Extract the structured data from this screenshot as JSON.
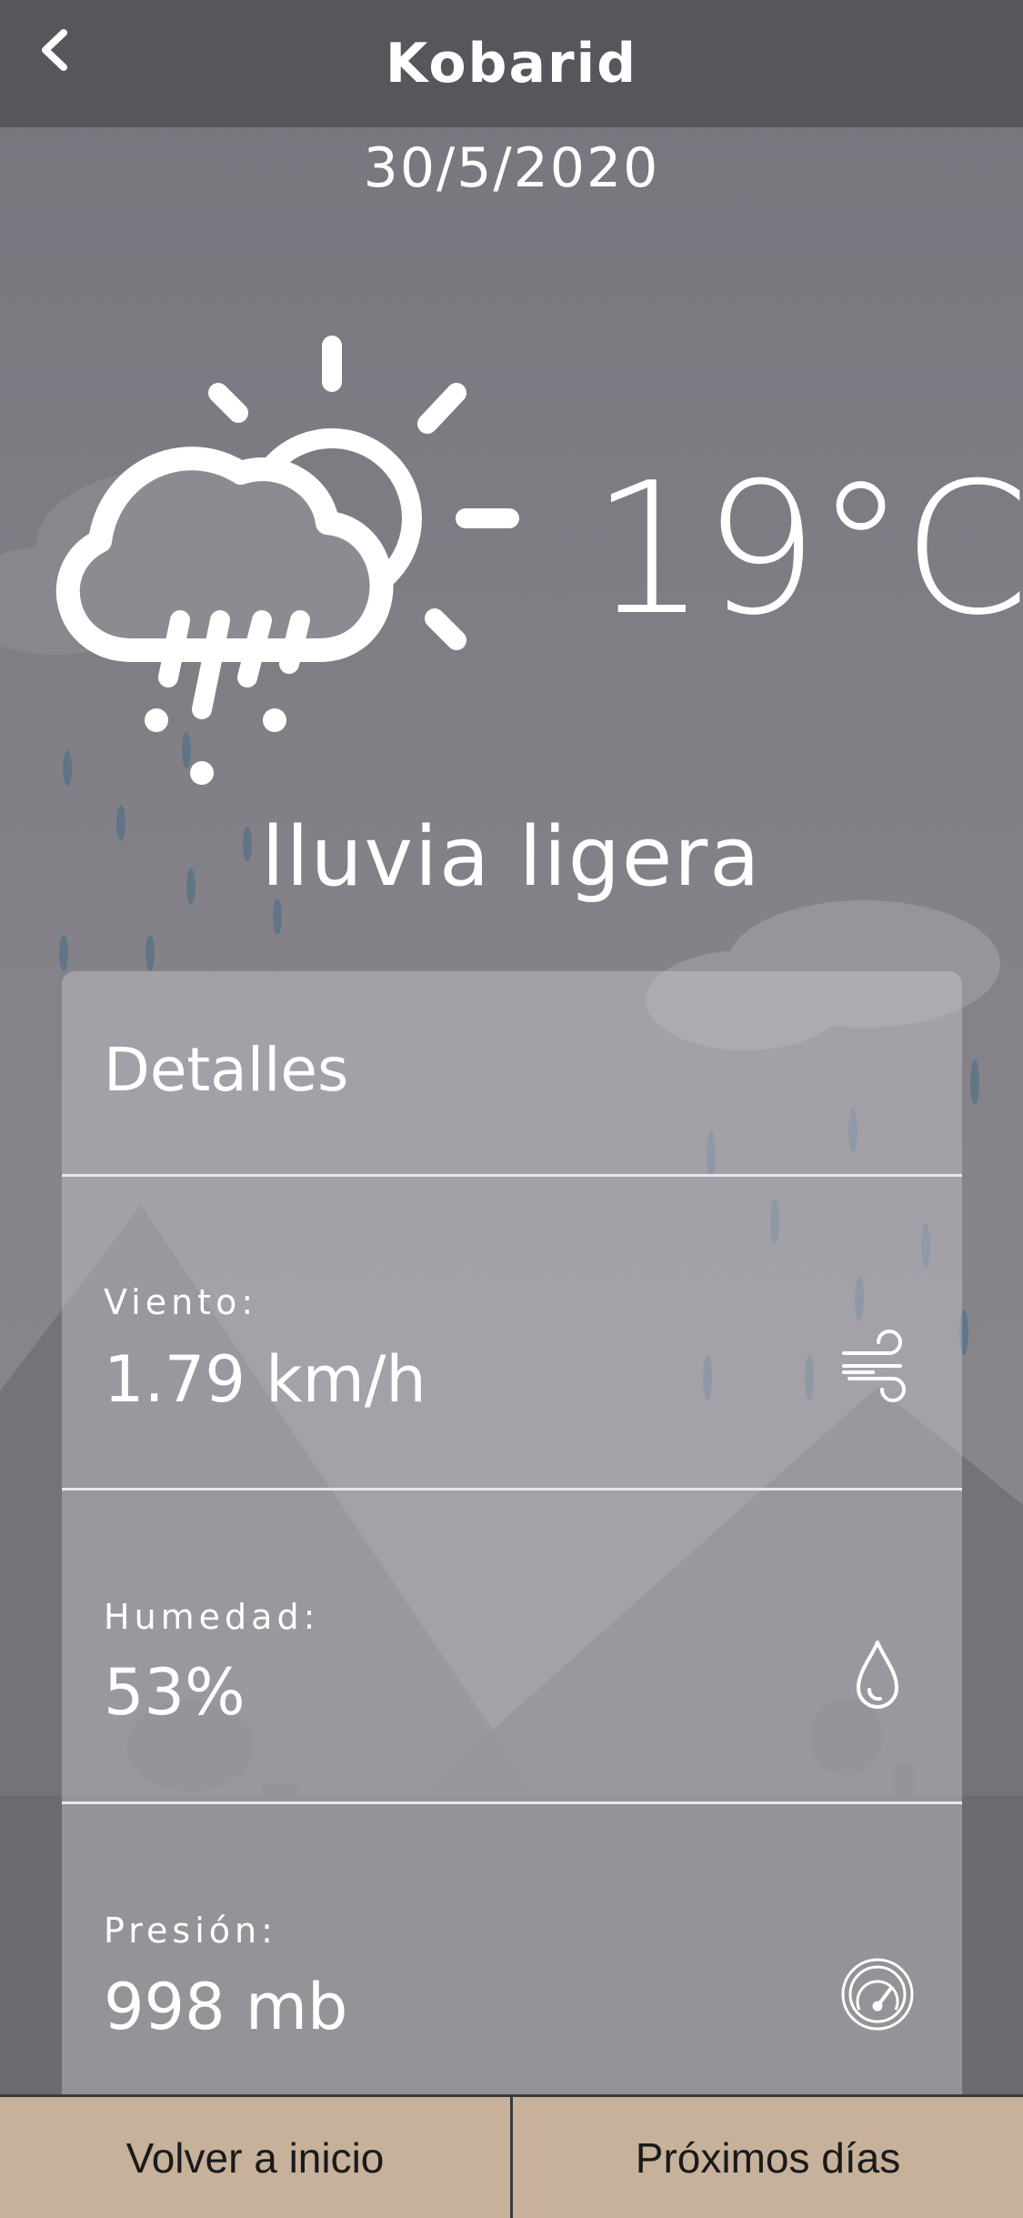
{
  "header": {
    "title": "Kobarid"
  },
  "date": "30/5/2020",
  "current": {
    "temperature": "19°C",
    "description": "lluvia ligera",
    "icon": "partly-sunny-rain-icon"
  },
  "details": {
    "title": "Detalles",
    "rows": [
      {
        "label": "Viento:",
        "value": "1.79 km/h",
        "icon": "wind-icon"
      },
      {
        "label": "Humedad:",
        "value": "53%",
        "icon": "water-drop-icon"
      },
      {
        "label": "Presión:",
        "value": "998 mb",
        "icon": "gauge-icon"
      }
    ]
  },
  "footer": {
    "home_label": "Volver a inicio",
    "next_label": "Próximos días"
  },
  "colors": {
    "header": "#58565c",
    "button": "#c7b19b",
    "text": "#ffffff"
  }
}
